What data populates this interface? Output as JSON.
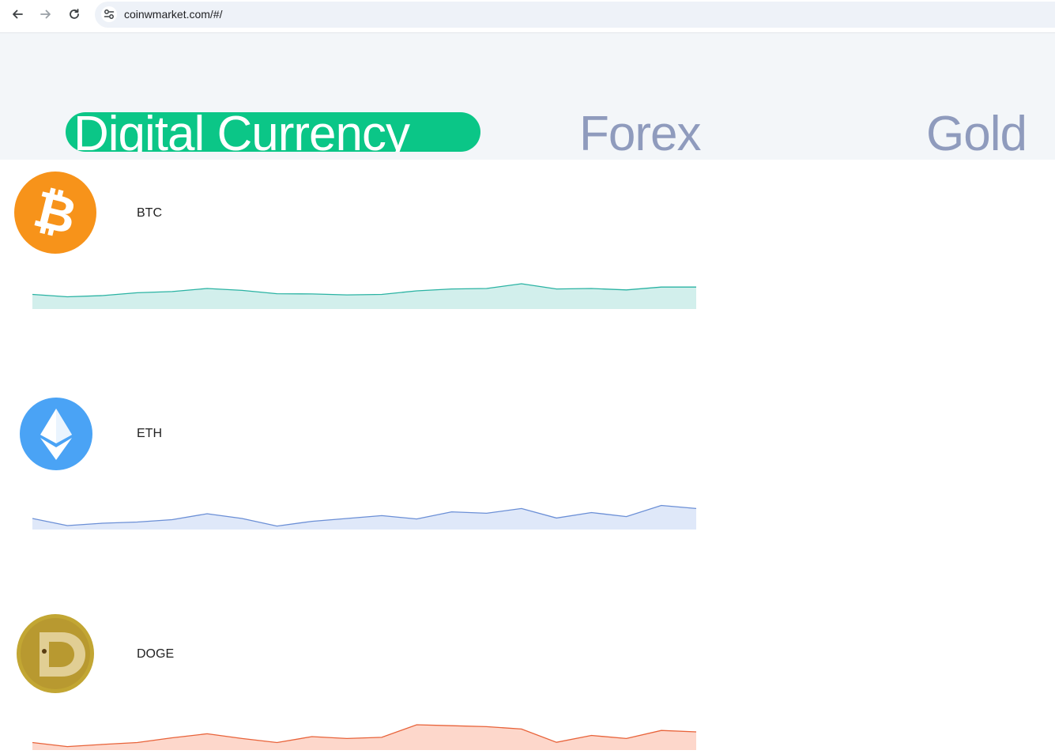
{
  "browser": {
    "url": "coinwmarket.com/#/",
    "back_icon": "arrow-left-icon",
    "forward_icon": "arrow-right-icon",
    "reload_icon": "reload-icon",
    "site_info_icon": "tune-icon"
  },
  "tabs": [
    {
      "label": "Digital Currency",
      "active": true
    },
    {
      "label": "Forex",
      "active": false
    },
    {
      "label": "Gold",
      "active": false
    }
  ],
  "colors": {
    "accent": "#0bc687",
    "inactive_tab": "#8f9bbd",
    "header_bg": "#f3f6f9"
  },
  "coins": [
    {
      "symbol": "BTC",
      "icon": "bitcoin-icon",
      "line_color": "#2bb3a3",
      "fill_color": "#d2efec",
      "trend": [
        0.55,
        0.45,
        0.5,
        0.62,
        0.67,
        0.8,
        0.72,
        0.58,
        0.57,
        0.53,
        0.55,
        0.7,
        0.78,
        0.8,
        1.0,
        0.78,
        0.8,
        0.74,
        0.86,
        0.86
      ]
    },
    {
      "symbol": "ETH",
      "icon": "ethereum-icon",
      "line_color": "#6b8fd6",
      "fill_color": "#dfe8f9",
      "trend": [
        0.4,
        0.1,
        0.2,
        0.25,
        0.35,
        0.6,
        0.4,
        0.08,
        0.28,
        0.4,
        0.52,
        0.38,
        0.68,
        0.62,
        0.82,
        0.42,
        0.65,
        0.48,
        0.95,
        0.82
      ]
    },
    {
      "symbol": "DOGE",
      "icon": "dogecoin-icon",
      "line_color": "#e8633a",
      "fill_color": "#fdd7cb",
      "trend": [
        0.25,
        0.08,
        0.17,
        0.25,
        0.45,
        0.62,
        0.42,
        0.25,
        0.5,
        0.42,
        0.47,
        1.0,
        0.96,
        0.92,
        0.82,
        0.26,
        0.55,
        0.42,
        0.76,
        0.7
      ]
    }
  ]
}
